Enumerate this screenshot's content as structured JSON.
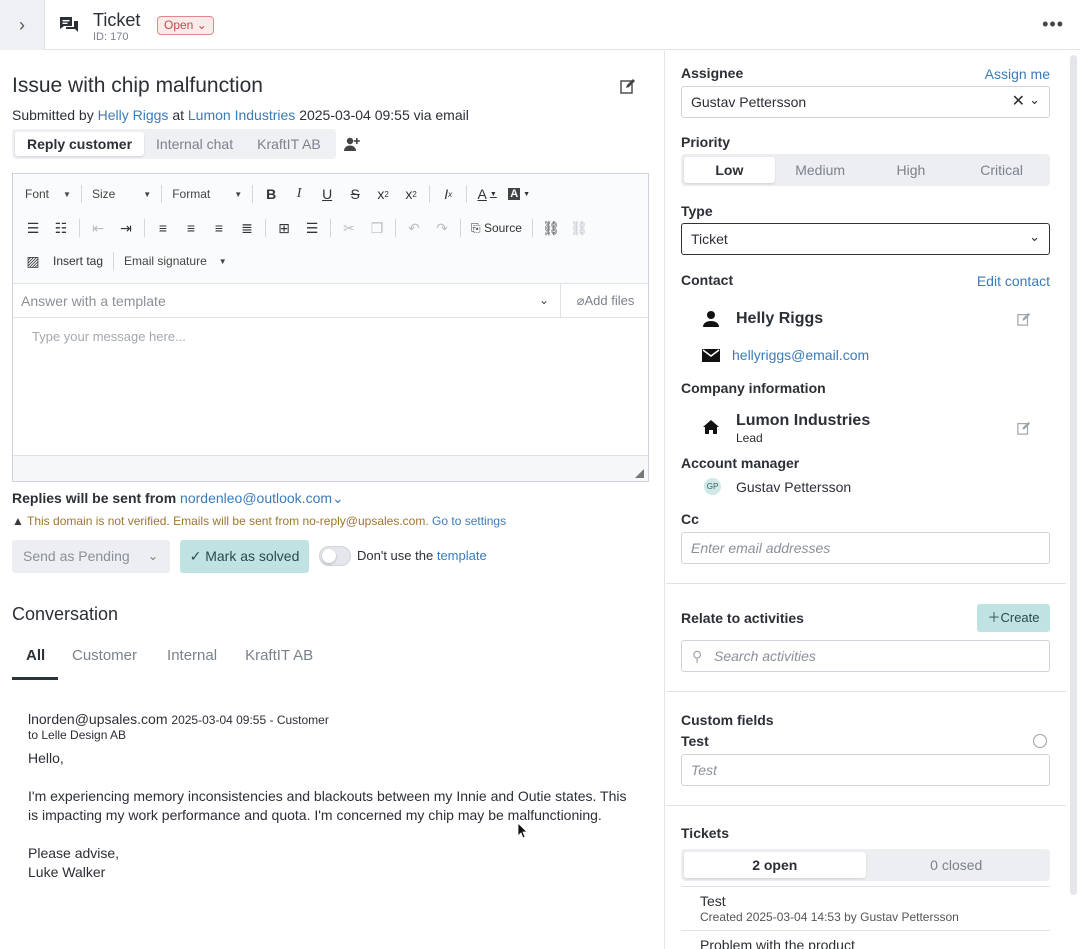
{
  "header": {
    "title": "Ticket",
    "id_label": "ID: 170",
    "status": "Open",
    "status_caret": "⌄",
    "collapse": "›",
    "more": "•••"
  },
  "ticket": {
    "title": "Issue with chip malfunction",
    "submitted_prefix": "Submitted by",
    "submitter": "Helly Riggs",
    "at": "at",
    "company": "Lumon Industries",
    "datetime_via": "2025-03-04 09:55 via email"
  },
  "reply_tabs": [
    "Reply customer",
    "Internal chat",
    "KraftIT AB"
  ],
  "editor": {
    "font_dd": "Font",
    "size_dd": "Size",
    "format_dd": "Format",
    "source_label": "Source",
    "insert_tag": "Insert tag",
    "email_signature": "Email signature",
    "template_placeholder": "Answer with a template",
    "add_files": "Add files",
    "message_placeholder": "Type your message here..."
  },
  "reply_settings": {
    "replies_prefix": "Replies will be sent from",
    "sender_email": "nordenleo@outlook.com",
    "warning_text": "This domain is not verified. Emails will be sent from no-reply@upsales.com.",
    "warning_link": "Go to settings",
    "send_as": "Send as Pending",
    "mark_solved": "Mark as solved",
    "toggle_prefix": "Don't use the",
    "toggle_link": "template"
  },
  "conversation": {
    "title": "Conversation",
    "tabs": [
      "All",
      "Customer",
      "Internal",
      "KraftIT AB"
    ],
    "message": {
      "from": "lnorden@upsales.com",
      "meta": "2025-03-04 09:55 - Customer",
      "to": "to Lelle Design AB",
      "body": "Hello,\n\nI'm experiencing memory inconsistencies and blackouts between my Innie and Outie states. This is impacting my work performance and quota. I'm concerned my chip may be malfunctioning.\n\nPlease advise,\nLuke Walker"
    }
  },
  "sidebar": {
    "assignee_label": "Assignee",
    "assign_me": "Assign me",
    "assignee_value": "Gustav Pettersson",
    "priority_label": "Priority",
    "priorities": [
      "Low",
      "Medium",
      "High",
      "Critical"
    ],
    "type_label": "Type",
    "type_value": "Ticket",
    "contact_label": "Contact",
    "edit_contact": "Edit contact",
    "contact_name": "Helly Riggs",
    "contact_email": "hellyriggs@email.com",
    "company_label": "Company information",
    "company_name": "Lumon Industries",
    "company_status": "Lead",
    "account_manager_label": "Account manager",
    "account_manager_initials": "GP",
    "account_manager_name": "Gustav Pettersson",
    "cc_label": "Cc",
    "cc_placeholder": "Enter email addresses",
    "relate_label": "Relate to activities",
    "create_label": "Create",
    "search_placeholder": "Search activities",
    "custom_fields_label": "Custom fields",
    "test_label": "Test",
    "test_placeholder": "Test",
    "tickets_label": "Tickets",
    "tickets_tabs": [
      "2 open",
      "0 closed"
    ],
    "tickets": [
      {
        "title": "Test",
        "meta": "Created 2025-03-04 14:53 by Gustav Pettersson"
      },
      {
        "title": "Problem with the product",
        "meta": ""
      }
    ]
  }
}
